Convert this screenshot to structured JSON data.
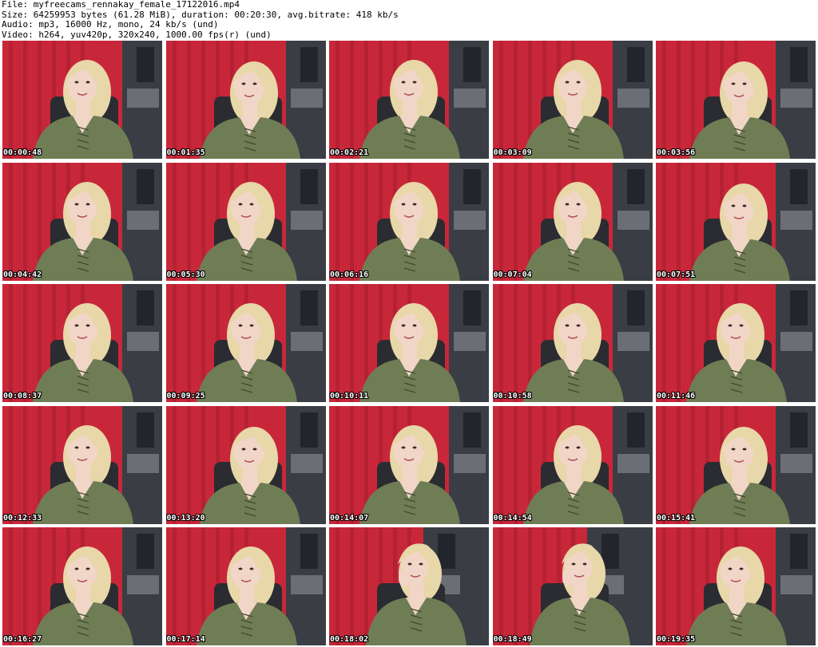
{
  "header": {
    "file_line": "File: myfreecams_rennakay_female_17122016.mp4",
    "size_line": "Size: 64259953 bytes (61.28 MiB), duration: 00:20:30, avg.bitrate: 418 kb/s",
    "audio_line": "Audio: mp3, 16000 Hz, mono, 24 kb/s (und)",
    "video_line": "Video: h264, yuv420p, 320x240, 1000.00 fps(r) (und)"
  },
  "colors": {
    "curtain": "#c8273a",
    "curtain_dark": "#9c1a2b",
    "wall": "#3a3d44",
    "sweater": "#6f7d55",
    "hair": "#e8d7a8",
    "skin": "#f1d6c8"
  },
  "thumbnails": [
    {
      "time": "00:00:48",
      "variant": "a"
    },
    {
      "time": "00:01:35",
      "variant": "b"
    },
    {
      "time": "00:02:21",
      "variant": "a"
    },
    {
      "time": "00:03:09",
      "variant": "a"
    },
    {
      "time": "00:03:56",
      "variant": "b"
    },
    {
      "time": "00:04:42",
      "variant": "a"
    },
    {
      "time": "00:05:30",
      "variant": "a"
    },
    {
      "time": "00:06:16",
      "variant": "a"
    },
    {
      "time": "00:07:04",
      "variant": "a"
    },
    {
      "time": "00:07:51",
      "variant": "b"
    },
    {
      "time": "00:08:37",
      "variant": "a"
    },
    {
      "time": "00:09:25",
      "variant": "a"
    },
    {
      "time": "00:10:11",
      "variant": "a"
    },
    {
      "time": "00:10:58",
      "variant": "a"
    },
    {
      "time": "00:11:46",
      "variant": "a"
    },
    {
      "time": "00:12:33",
      "variant": "a"
    },
    {
      "time": "00:13:20",
      "variant": "b"
    },
    {
      "time": "00:14:07",
      "variant": "a"
    },
    {
      "time": "00:14:54",
      "variant": "a"
    },
    {
      "time": "00:15:41",
      "variant": "b"
    },
    {
      "time": "00:16:27",
      "variant": "a"
    },
    {
      "time": "00:17:14",
      "variant": "a"
    },
    {
      "time": "00:18:02",
      "variant": "c"
    },
    {
      "time": "00:18:49",
      "variant": "c"
    },
    {
      "time": "00:19:35",
      "variant": "a"
    }
  ]
}
